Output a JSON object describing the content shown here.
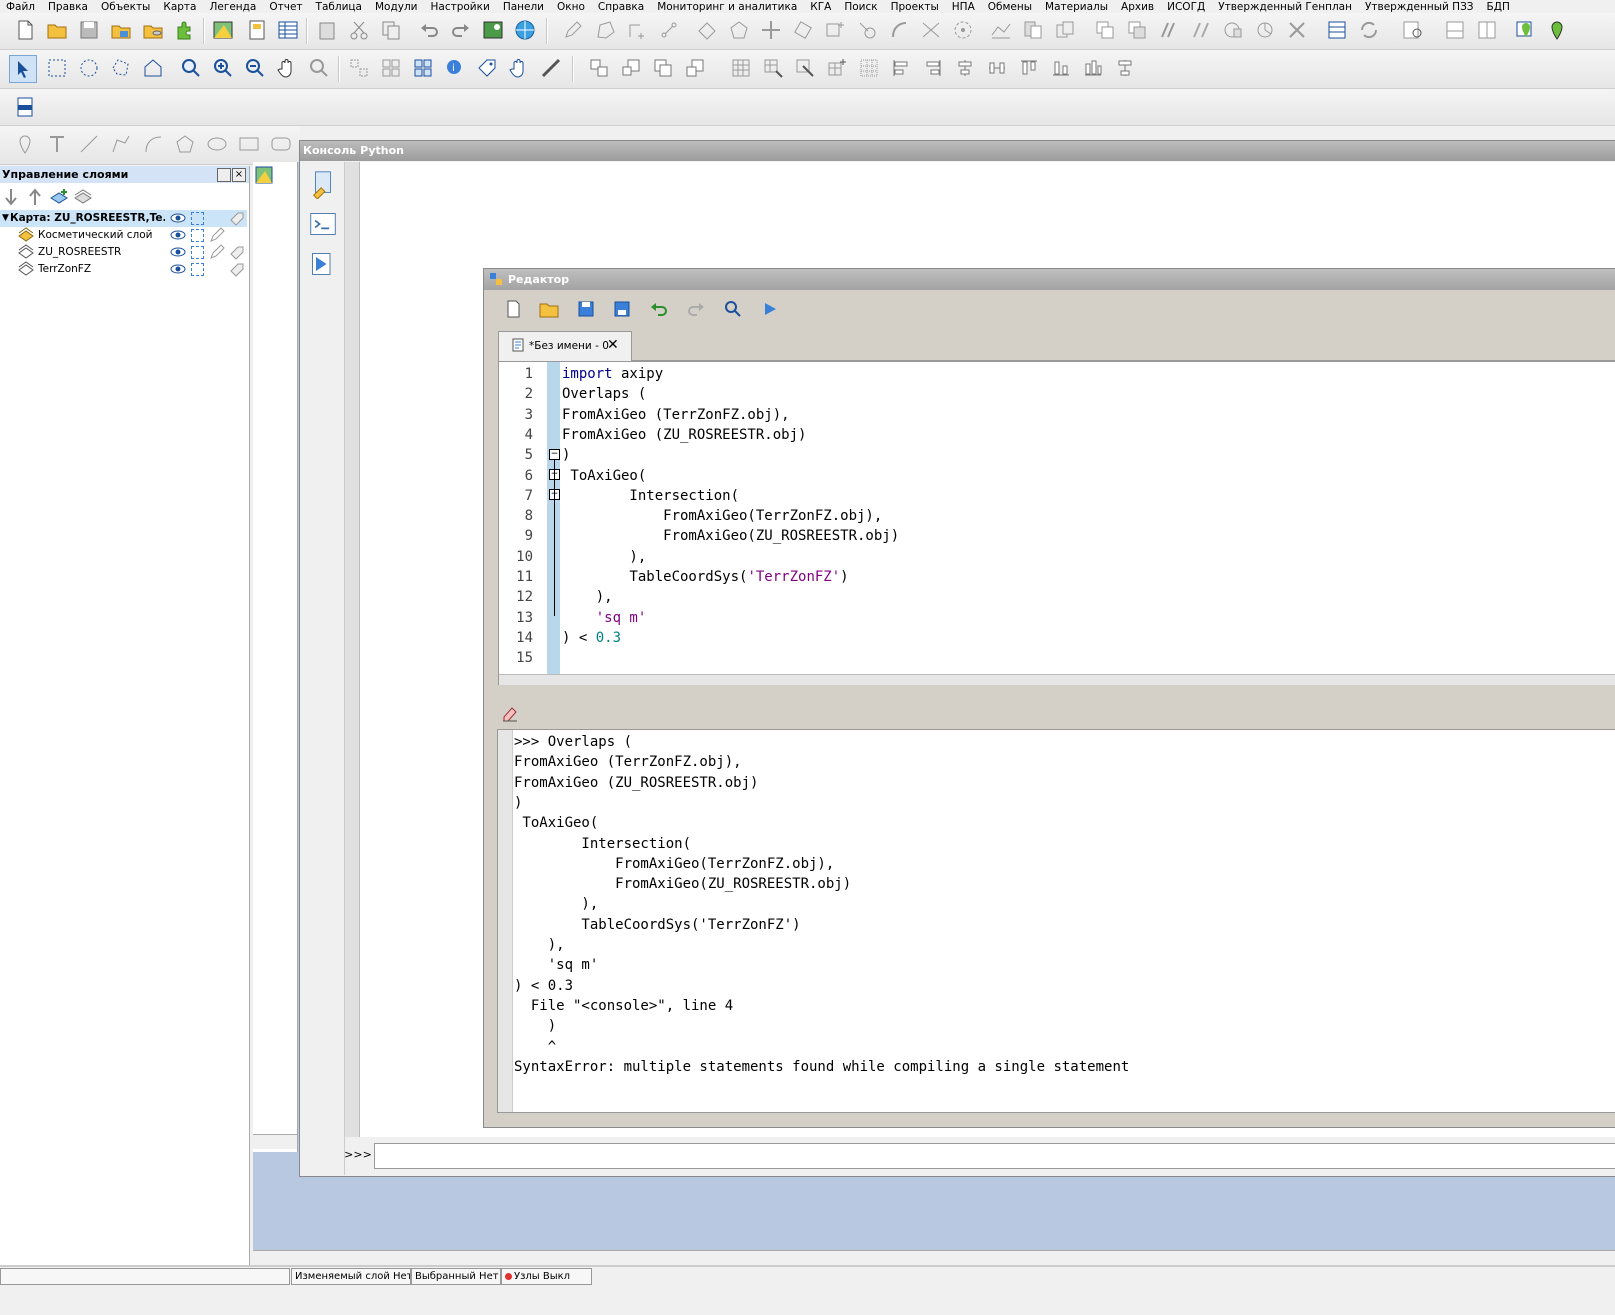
{
  "menu": [
    "Файл",
    "Правка",
    "Объекты",
    "Карта",
    "Легенда",
    "Отчет",
    "Таблица",
    "Модули",
    "Настройки",
    "Панели",
    "Окно",
    "Справка",
    "Мониторинг и аналитика",
    "КГА",
    "Поиск",
    "Проекты",
    "НПА",
    "Обмены",
    "Материалы",
    "Архив",
    "ИСОГД",
    "Утвержденный Генплан",
    "Утвержденный ПЗЗ",
    "БДП"
  ],
  "layers_panel": {
    "title": "Управление слоями",
    "map_node": "Карта: ZU_ROSREESTR,Te...",
    "layers": [
      "Косметический слой",
      "ZU_ROSREESTR",
      "TerrZonFZ"
    ]
  },
  "python_console": {
    "title": "Консоль Python",
    "prompt": ">>>"
  },
  "editor": {
    "title": "Редактор",
    "tab_label": "*Без имени - 0",
    "line_numbers": [
      "1",
      "2",
      "3",
      "4",
      "5",
      "6",
      "7",
      "8",
      "9",
      "10",
      "11",
      "12",
      "13",
      "14",
      "15"
    ],
    "code_lines": [
      {
        "kw": "import",
        "rest": " axipy"
      },
      {
        "text": "Overlaps ("
      },
      {
        "text": "FromAxiGeo (TerrZonFZ.obj),"
      },
      {
        "text": "FromAxiGeo (ZU_ROSREESTR.obj)"
      },
      {
        "text": ")"
      },
      {
        "text": " ToAxiGeo("
      },
      {
        "text": "        Intersection("
      },
      {
        "text": "            FromAxiGeo(TerrZonFZ.obj),"
      },
      {
        "text": "            FromAxiGeo(ZU_ROSREESTR.obj)"
      },
      {
        "text": "        ),"
      },
      {
        "pre": "        TableCoordSys(",
        "str": "'TerrZonFZ'",
        "post": ")"
      },
      {
        "text": "    ),"
      },
      {
        "pre": "    ",
        "str": "'sq m'",
        "post": ""
      },
      {
        "pre": ") < ",
        "num": "0.3",
        "post": ""
      },
      {
        "text": ""
      }
    ]
  },
  "output_lines": [
    ">>> Overlaps (",
    "FromAxiGeo (TerrZonFZ.obj),",
    "FromAxiGeo (ZU_ROSREESTR.obj)",
    ")",
    " ToAxiGeo(",
    "        Intersection(",
    "            FromAxiGeo(TerrZonFZ.obj),",
    "            FromAxiGeo(ZU_ROSREESTR.obj)",
    "        ),",
    "        TableCoordSys('TerrZonFZ')",
    "    ),",
    "    'sq m'",
    ") < 0.3",
    "  File \"<console>\", line 4",
    "    )",
    "    ^",
    "SyntaxError: multiple statements found while compiling a single statement"
  ],
  "statusbar": [
    "Изменяемый слой Нет",
    "Выбранный Нет",
    "Узлы Выкл"
  ],
  "colors": {
    "accent": "#b0c4de",
    "selection": "#cce4f7"
  }
}
